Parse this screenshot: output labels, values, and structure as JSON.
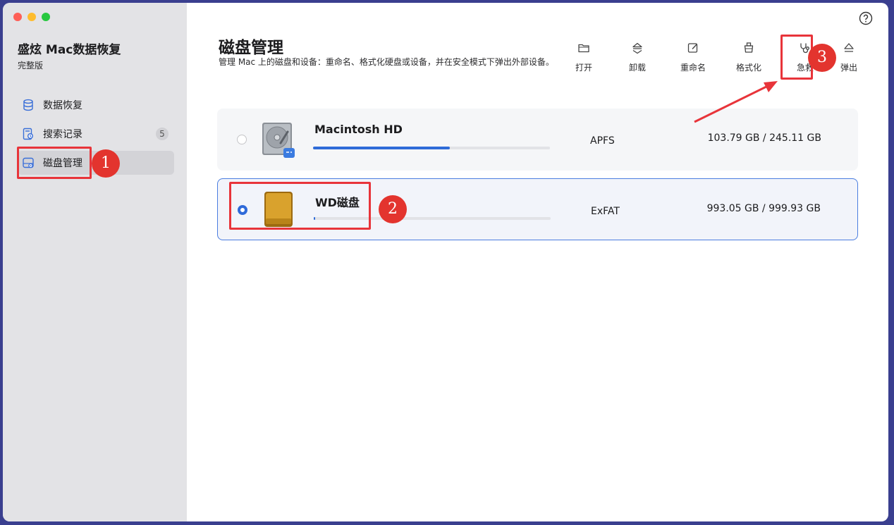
{
  "app": {
    "title": "盛炫 Mac数据恢复",
    "edition": "完整版"
  },
  "sidebar": {
    "items": [
      {
        "label": "数据恢复",
        "icon": "database-icon"
      },
      {
        "label": "搜索记录",
        "icon": "search-history-icon",
        "badge": "5"
      },
      {
        "label": "磁盘管理",
        "icon": "disk-manage-icon",
        "active": true
      }
    ]
  },
  "main": {
    "title": "磁盘管理",
    "subtitle": "管理 Mac 上的磁盘和设备：重命名、格式化硬盘或设备，并在安全模式下弹出外部设备。"
  },
  "toolbar": {
    "open": "打开",
    "unmount": "卸载",
    "rename": "重命名",
    "format": "格式化",
    "rescue": "急救",
    "eject": "弹出"
  },
  "disks": [
    {
      "name": "Macintosh HD",
      "fs": "APFS",
      "capacity": "103.79 GB / 245.11 GB",
      "bar_fraction": 0.577,
      "selected": false
    },
    {
      "name": "WD磁盘",
      "fs": "ExFAT",
      "capacity": "993.05 GB / 999.93 GB",
      "bar_fraction": 0.006,
      "selected": true
    }
  ],
  "annotations": {
    "one": "1",
    "two": "2",
    "three": "3",
    "color": "#e8343a"
  }
}
